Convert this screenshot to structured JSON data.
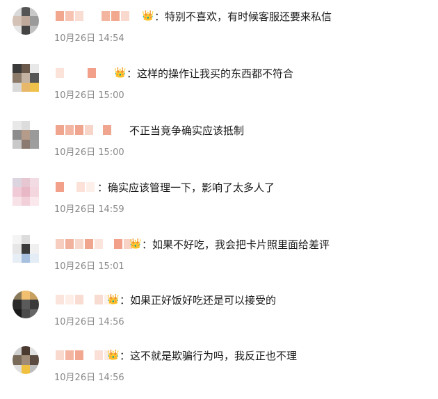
{
  "colors": {
    "text": "#1a1a1a",
    "time": "#888888",
    "crown": "#f0a020",
    "name_pink": "#f4a08a"
  },
  "comments": [
    {
      "text": "：特别不喜欢，有时候客服还要来私信",
      "time": "10月26日 14:54",
      "crown_icon": "crown-icon"
    },
    {
      "text": "：这样的操作让我买的东西都不符合",
      "time": "10月26日 15:00",
      "crown_icon": "crown-icon"
    },
    {
      "text": "不正当竞争确实应该抵制",
      "time": "10月26日 15:00"
    },
    {
      "text": "：确实应该管理一下，影响了太多人了",
      "time": "10月26日 14:59"
    },
    {
      "text": "：如果不好吃，我会把卡片照里面给差评",
      "time": "10月26日 15:01",
      "crown_icon": "crown-icon"
    },
    {
      "text": "：如果正好饭好吃还是可以接受的",
      "time": "10月26日 14:56",
      "crown_icon": "crown-icon"
    },
    {
      "text": "：这不就是欺骗行为吗，我反正也不理",
      "time": "10月26日 14:56",
      "crown_icon": "crown-icon"
    }
  ]
}
